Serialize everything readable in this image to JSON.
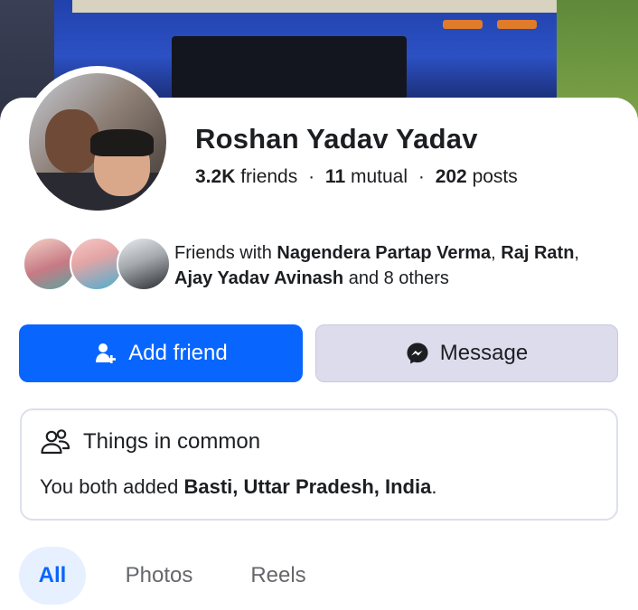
{
  "profile": {
    "name": "Roshan Yadav Yadav",
    "stats": {
      "friends_count": "3.2K",
      "friends_label": "friends",
      "mutual_count": "11",
      "mutual_label": "mutual",
      "posts_count": "202",
      "posts_label": "posts",
      "separator": "·"
    }
  },
  "mutual_friends": {
    "prefix": "Friends with",
    "friend1": "Nagendera Partap Verma",
    "comma1": ", ",
    "friend2": "Raj Ratn",
    "comma2": ", ",
    "friend3": "Ajay Yadav Avinash",
    "suffix": " and 8 others"
  },
  "actions": {
    "add_friend_label": "Add friend",
    "message_label": "Message"
  },
  "things_in_common": {
    "title": "Things in common",
    "body_prefix": "You both added ",
    "place": "Basti, Uttar Pradesh, India",
    "body_suffix": "."
  },
  "tabs": [
    {
      "label": "All",
      "active": true
    },
    {
      "label": "Photos",
      "active": false
    },
    {
      "label": "Reels",
      "active": false
    }
  ],
  "colors": {
    "accent": "#0866ff",
    "message_button": "#dcdcec",
    "active_tab_bg": "#e7f0fe"
  },
  "icons": {
    "add_friend": "add-person-icon",
    "message": "messenger-icon",
    "common": "people-group-icon"
  }
}
